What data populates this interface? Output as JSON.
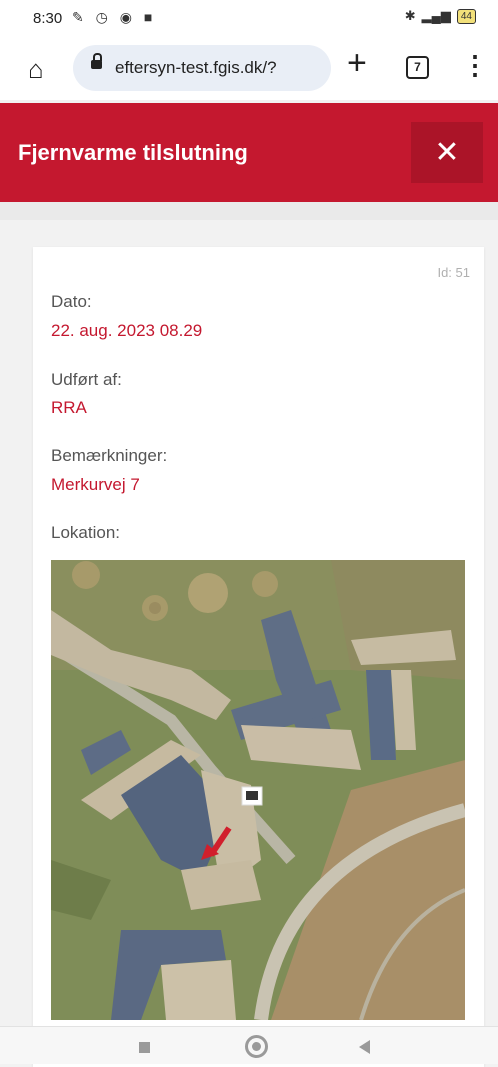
{
  "status_bar": {
    "time": "8:30",
    "battery": "44"
  },
  "browser": {
    "url": "eftersyn-test.fgis.dk/?",
    "tab_count": "7"
  },
  "header": {
    "title": "Fjernvarme tilslutning",
    "close_icon": "close-icon"
  },
  "record": {
    "id": "Id: 51",
    "fields": [
      {
        "label": "Dato:",
        "value": "22. aug. 2023 08.29"
      },
      {
        "label": "Udført af:",
        "value": "RRA"
      },
      {
        "label": "Bemærkninger:",
        "value": "Merkurvej 7"
      },
      {
        "label": "Lokation:"
      }
    ]
  },
  "colors": {
    "accent": "#c4182f",
    "header_bg": "#c4182f",
    "close_bg": "#ab1428"
  }
}
